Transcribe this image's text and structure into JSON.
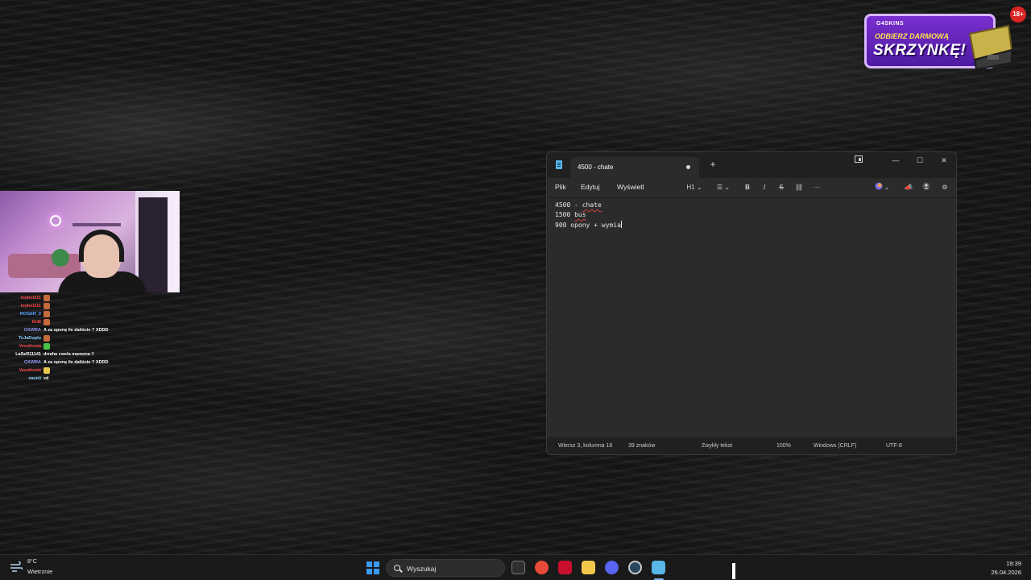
{
  "overlay": {
    "promo": {
      "brand": "G4SKINS",
      "line1": "ODBIERZ DARMOWĄ",
      "line2": "SKRZYNKĘ!",
      "age_badge": "18+"
    },
    "chat": [
      {
        "user": "toyboi211",
        "message": "",
        "user_color": "#ff4a4a",
        "emote_color": "#c66a3a"
      },
      {
        "user": "toyboi211",
        "message": "",
        "user_color": "#ff4a4a",
        "emote_color": "#c66a3a"
      },
      {
        "user": "ROGER_0",
        "message": "",
        "user_color": "#5aa0ff",
        "emote_color": "#c66a3a"
      },
      {
        "user": "DnB",
        "message": "",
        "user_color": "#ff4a4a",
        "emote_color": "#c66a3a"
      },
      {
        "user": "OXWRA",
        "message": "A za oponę ile daliście ? XDDD",
        "user_color": "#9a9aff",
        "emote_color": ""
      },
      {
        "user": "ToJaDuplo",
        "message": "",
        "user_color": "#8ad4ff",
        "emote_color": "#c66a3a"
      },
      {
        "user": "Vexofrexia",
        "message": "",
        "user_color": "#ff4a4a",
        "emote_color": "#4ac24a"
      },
      {
        "user": "LaSeR11141",
        "message": "drraha cwela mamona !!",
        "user_color": "#ffffff",
        "emote_color": ""
      },
      {
        "user": "OXWRA",
        "message": "A za oponę ile daliście ? XDDD",
        "user_color": "#9a9aff",
        "emote_color": ""
      },
      {
        "user": "Vexofrexia",
        "message": "",
        "user_color": "#ff4a4a",
        "emote_color": "#e8c84a"
      },
      {
        "user": "zaunii",
        "message": "xd",
        "user_color": "#8ad4ff",
        "emote_color": ""
      }
    ]
  },
  "notepad": {
    "tab_title": "4500 - chate",
    "menu": [
      "Plik",
      "Edytuj",
      "Wyświetl"
    ],
    "toolbar": {
      "heading": "H1",
      "bold": "B",
      "italic": "I",
      "strike": "S",
      "more": "···"
    },
    "content": {
      "line1_text": "4500 - ",
      "line1_word": "chate",
      "line2_text": "1500 ",
      "line2_word": "bus",
      "line3_text": "900 opony + wymia"
    },
    "status": {
      "position": "Wiersz 3, kolumna 18",
      "chars": "39 znaków",
      "format": "Zwykły tekst",
      "zoom": "100%",
      "line_endings": "Windows (CRLF)",
      "encoding": "UTF-8"
    }
  },
  "taskbar": {
    "weather_temp": "8°C",
    "weather_desc": "Wietrznie",
    "search_placeholder": "Wyszukaj",
    "time": "19:39",
    "date": "26.04.2026",
    "apps": [
      {
        "name": "file-explorer-icon",
        "color": "#f2c84b"
      },
      {
        "name": "chrome-icon",
        "color": "#e84a3a"
      },
      {
        "name": "acrobat-icon",
        "color": "#c8102e"
      },
      {
        "name": "folder-icon",
        "color": "#f2c84b"
      },
      {
        "name": "discord-icon",
        "color": "#5865f2"
      },
      {
        "name": "steam-icon",
        "color": "#2a475e"
      },
      {
        "name": "notepad-icon",
        "color": "#58b6e8"
      }
    ]
  }
}
